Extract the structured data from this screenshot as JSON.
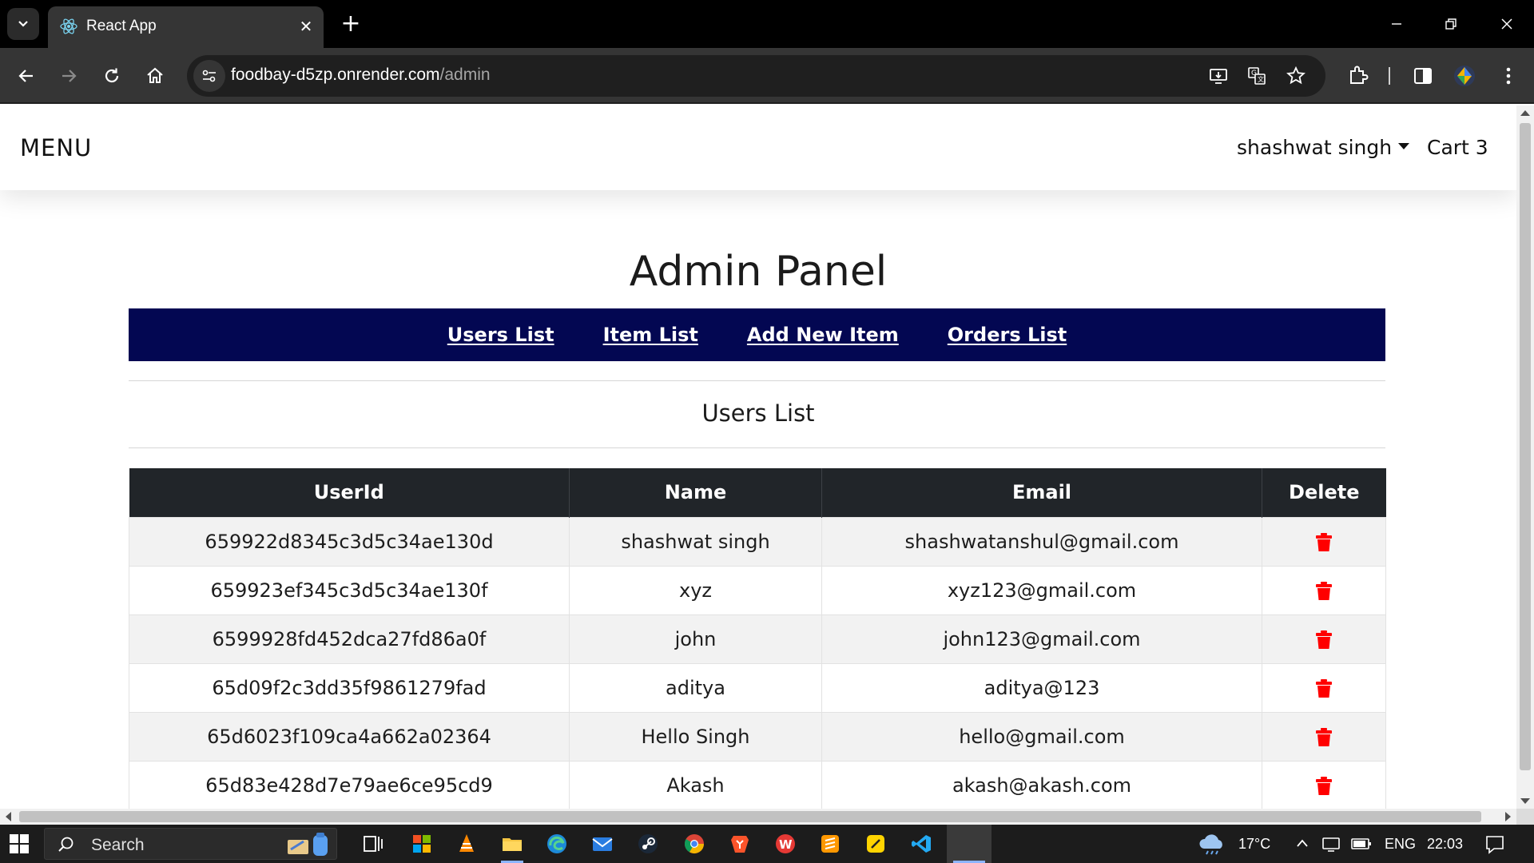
{
  "browser": {
    "tab_title": "React App",
    "url_host": "foodbay-d5zp.onrender.com",
    "url_path": "/admin",
    "new_tab": "+",
    "close_tab": "✕"
  },
  "site": {
    "brand": "MENU",
    "user_name": "shashwat singh",
    "cart_label": "Cart 3"
  },
  "admin": {
    "title": "Admin Panel",
    "nav": [
      "Users List",
      "Item List",
      "Add New Item",
      "Orders List"
    ],
    "section_title": "Users List",
    "columns": [
      "UserId",
      "Name",
      "Email",
      "Delete"
    ],
    "rows": [
      {
        "id": "659922d8345c3d5c34ae130d",
        "name": "shashwat singh",
        "email": "shashwatanshul@gmail.com"
      },
      {
        "id": "659923ef345c3d5c34ae130f",
        "name": "xyz",
        "email": "xyz123@gmail.com"
      },
      {
        "id": "6599928fd452dca27fd86a0f",
        "name": "john",
        "email": "john123@gmail.com"
      },
      {
        "id": "65d09f2c3dd35f9861279fad",
        "name": "aditya",
        "email": "aditya@123"
      },
      {
        "id": "65d6023f109ca4a662a02364",
        "name": "Hello Singh",
        "email": "hello@gmail.com"
      },
      {
        "id": "65d83e428d7e79ae6ce95cd9",
        "name": "Akash",
        "email": "akash@akash.com"
      }
    ],
    "delete_icon": "trash-icon",
    "delete_color": "#ff0000",
    "nav_bg": "#030752"
  },
  "taskbar": {
    "search_label": "Search",
    "weather": "17°C",
    "language": "ENG",
    "time": "22:03"
  }
}
